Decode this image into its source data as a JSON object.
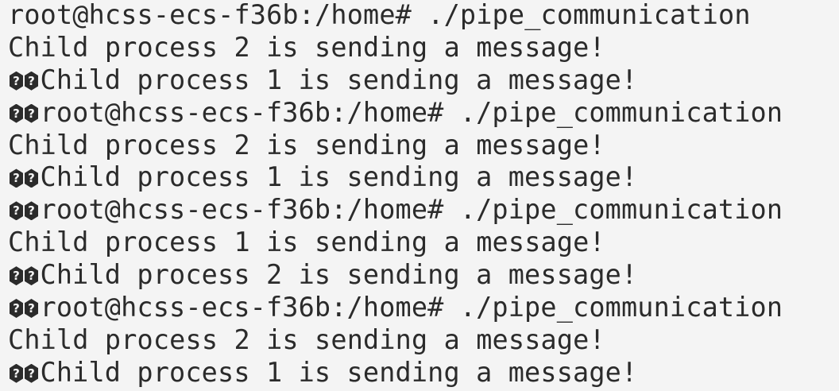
{
  "terminal": {
    "lines": [
      {
        "prefix": "",
        "text": "root@hcss-ecs-f36b:/home# ./pipe_communication"
      },
      {
        "prefix": "",
        "text": "Child process 2 is sending a message!"
      },
      {
        "prefix": "��",
        "text": "Child process 1 is sending a message!"
      },
      {
        "prefix": "��",
        "text": "root@hcss-ecs-f36b:/home# ./pipe_communication"
      },
      {
        "prefix": "",
        "text": "Child process 2 is sending a message!"
      },
      {
        "prefix": "��",
        "text": "Child process 1 is sending a message!"
      },
      {
        "prefix": "��",
        "text": "root@hcss-ecs-f36b:/home# ./pipe_communication"
      },
      {
        "prefix": "",
        "text": "Child process 1 is sending a message!"
      },
      {
        "prefix": "��",
        "text": "Child process 2 is sending a message!"
      },
      {
        "prefix": "��",
        "text": "root@hcss-ecs-f36b:/home# ./pipe_communication"
      },
      {
        "prefix": "",
        "text": "Child process 2 is sending a message!"
      },
      {
        "prefix": "��",
        "text": "Child process 1 is sending a message!"
      }
    ]
  }
}
